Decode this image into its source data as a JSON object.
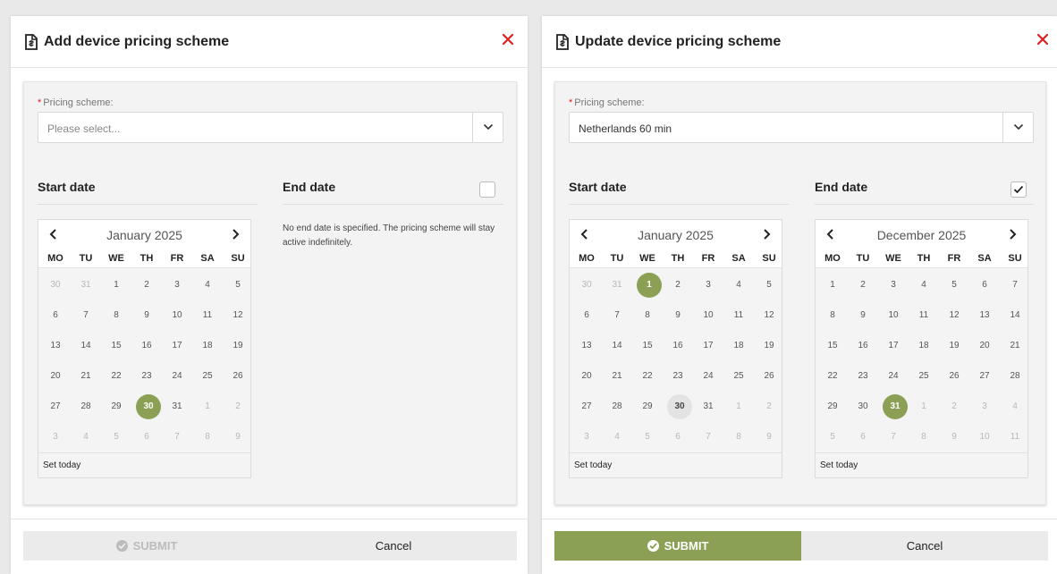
{
  "colors": {
    "accent": "#8ba055",
    "close": "#e02020",
    "panel": "#f3f3f3"
  },
  "weekdays": [
    "MO",
    "TU",
    "WE",
    "TH",
    "FR",
    "SA",
    "SU"
  ],
  "add_dialog": {
    "title": "Add device pricing scheme",
    "title_icon": "document-icon",
    "close_icon": "close-icon",
    "pricing_label": "Pricing scheme:",
    "required_mark": "*",
    "pricing_value": "",
    "pricing_placeholder": "Please select...",
    "start_title": "Start date",
    "end_title": "End date",
    "end_checked": false,
    "no_end_text": "No end date is specified. The pricing scheme will stay active indefinitely.",
    "start_calendar": {
      "month_label": "January 2025",
      "selected": "30",
      "days": [
        {
          "d": "30",
          "o": true
        },
        {
          "d": "31",
          "o": true
        },
        {
          "d": "1"
        },
        {
          "d": "2"
        },
        {
          "d": "3"
        },
        {
          "d": "4"
        },
        {
          "d": "5"
        },
        {
          "d": "6"
        },
        {
          "d": "7"
        },
        {
          "d": "8"
        },
        {
          "d": "9"
        },
        {
          "d": "10"
        },
        {
          "d": "11"
        },
        {
          "d": "12"
        },
        {
          "d": "13"
        },
        {
          "d": "14"
        },
        {
          "d": "15"
        },
        {
          "d": "16"
        },
        {
          "d": "17"
        },
        {
          "d": "18"
        },
        {
          "d": "19"
        },
        {
          "d": "20"
        },
        {
          "d": "21"
        },
        {
          "d": "22"
        },
        {
          "d": "23"
        },
        {
          "d": "24"
        },
        {
          "d": "25"
        },
        {
          "d": "26"
        },
        {
          "d": "27"
        },
        {
          "d": "28"
        },
        {
          "d": "29"
        },
        {
          "d": "30",
          "s": true
        },
        {
          "d": "31"
        },
        {
          "d": "1",
          "o": true
        },
        {
          "d": "2",
          "o": true
        },
        {
          "d": "3",
          "o": true
        },
        {
          "d": "4",
          "o": true
        },
        {
          "d": "5",
          "o": true
        },
        {
          "d": "6",
          "o": true
        },
        {
          "d": "7",
          "o": true
        },
        {
          "d": "8",
          "o": true
        },
        {
          "d": "9",
          "o": true
        }
      ],
      "set_today": "Set today"
    },
    "submit_label": "SUBMIT",
    "submit_enabled": false,
    "cancel_label": "Cancel"
  },
  "update_dialog": {
    "title": "Update device pricing scheme",
    "title_icon": "document-icon",
    "close_icon": "close-icon",
    "pricing_label": "Pricing scheme:",
    "required_mark": "*",
    "pricing_value": "Netherlands 60 min",
    "start_title": "Start date",
    "end_title": "End date",
    "end_checked": true,
    "start_calendar": {
      "month_label": "January 2025",
      "days": [
        {
          "d": "30",
          "o": true
        },
        {
          "d": "31",
          "o": true
        },
        {
          "d": "1",
          "s": true
        },
        {
          "d": "2"
        },
        {
          "d": "3"
        },
        {
          "d": "4"
        },
        {
          "d": "5"
        },
        {
          "d": "6"
        },
        {
          "d": "7"
        },
        {
          "d": "8"
        },
        {
          "d": "9"
        },
        {
          "d": "10"
        },
        {
          "d": "11"
        },
        {
          "d": "12"
        },
        {
          "d": "13"
        },
        {
          "d": "14"
        },
        {
          "d": "15"
        },
        {
          "d": "16"
        },
        {
          "d": "17"
        },
        {
          "d": "18"
        },
        {
          "d": "19"
        },
        {
          "d": "20"
        },
        {
          "d": "21"
        },
        {
          "d": "22"
        },
        {
          "d": "23"
        },
        {
          "d": "24"
        },
        {
          "d": "25"
        },
        {
          "d": "26"
        },
        {
          "d": "27"
        },
        {
          "d": "28"
        },
        {
          "d": "29"
        },
        {
          "d": "30",
          "t": true
        },
        {
          "d": "31"
        },
        {
          "d": "1",
          "o": true
        },
        {
          "d": "2",
          "o": true
        },
        {
          "d": "3",
          "o": true
        },
        {
          "d": "4",
          "o": true
        },
        {
          "d": "5",
          "o": true
        },
        {
          "d": "6",
          "o": true
        },
        {
          "d": "7",
          "o": true
        },
        {
          "d": "8",
          "o": true
        },
        {
          "d": "9",
          "o": true
        }
      ],
      "set_today": "Set today"
    },
    "end_calendar": {
      "month_label": "December 2025",
      "days": [
        {
          "d": "1"
        },
        {
          "d": "2"
        },
        {
          "d": "3"
        },
        {
          "d": "4"
        },
        {
          "d": "5"
        },
        {
          "d": "6"
        },
        {
          "d": "7"
        },
        {
          "d": "8"
        },
        {
          "d": "9"
        },
        {
          "d": "10"
        },
        {
          "d": "11"
        },
        {
          "d": "12"
        },
        {
          "d": "13"
        },
        {
          "d": "14"
        },
        {
          "d": "15"
        },
        {
          "d": "16"
        },
        {
          "d": "17"
        },
        {
          "d": "18"
        },
        {
          "d": "19"
        },
        {
          "d": "20"
        },
        {
          "d": "21"
        },
        {
          "d": "22"
        },
        {
          "d": "23"
        },
        {
          "d": "24"
        },
        {
          "d": "25"
        },
        {
          "d": "26"
        },
        {
          "d": "27"
        },
        {
          "d": "28"
        },
        {
          "d": "29"
        },
        {
          "d": "30"
        },
        {
          "d": "31",
          "s": true
        },
        {
          "d": "1",
          "o": true
        },
        {
          "d": "2",
          "o": true
        },
        {
          "d": "3",
          "o": true
        },
        {
          "d": "4",
          "o": true
        },
        {
          "d": "5",
          "o": true
        },
        {
          "d": "6",
          "o": true
        },
        {
          "d": "7",
          "o": true
        },
        {
          "d": "8",
          "o": true
        },
        {
          "d": "9",
          "o": true
        },
        {
          "d": "10",
          "o": true
        },
        {
          "d": "11",
          "o": true
        }
      ],
      "set_today": "Set today"
    },
    "submit_label": "SUBMIT",
    "submit_enabled": true,
    "cancel_label": "Cancel"
  }
}
